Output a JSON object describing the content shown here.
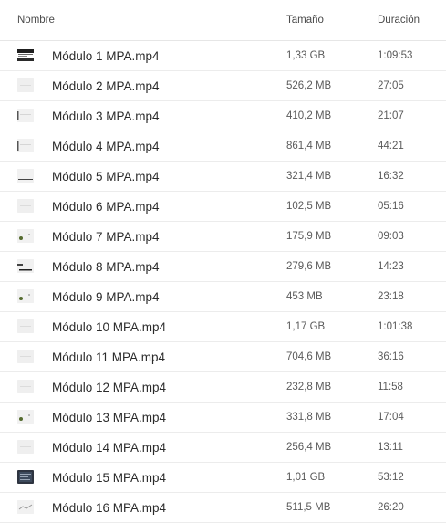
{
  "columns": {
    "name": "Nombre",
    "size": "Tamaño",
    "duration": "Duración"
  },
  "files": [
    {
      "name": "Módulo 1 MPA.mp4",
      "size": "1,33 GB",
      "duration": "1:09:53",
      "thumb": "dark-slide"
    },
    {
      "name": "Módulo 2 MPA.mp4",
      "size": "526,2 MB",
      "duration": "27:05",
      "thumb": "light"
    },
    {
      "name": "Módulo 3 MPA.mp4",
      "size": "410,2 MB",
      "duration": "21:07",
      "thumb": "light-left"
    },
    {
      "name": "Módulo 4 MPA.mp4",
      "size": "861,4 MB",
      "duration": "44:21",
      "thumb": "light-left"
    },
    {
      "name": "Módulo 5 MPA.mp4",
      "size": "321,4 MB",
      "duration": "16:32",
      "thumb": "light-line"
    },
    {
      "name": "Módulo 6 MPA.mp4",
      "size": "102,5 MB",
      "duration": "05:16",
      "thumb": "light"
    },
    {
      "name": "Módulo 7 MPA.mp4",
      "size": "175,9 MB",
      "duration": "09:03",
      "thumb": "light-dots"
    },
    {
      "name": "Módulo 8 MPA.mp4",
      "size": "279,6 MB",
      "duration": "14:23",
      "thumb": "light-bar"
    },
    {
      "name": "Módulo 9 MPA.mp4",
      "size": "453 MB",
      "duration": "23:18",
      "thumb": "light-dots"
    },
    {
      "name": "Módulo 10 MPA.mp4",
      "size": "1,17 GB",
      "duration": "1:01:38",
      "thumb": "light"
    },
    {
      "name": "Módulo 11 MPA.mp4",
      "size": "704,6 MB",
      "duration": "36:16",
      "thumb": "light"
    },
    {
      "name": "Módulo 12 MPA.mp4",
      "size": "232,8 MB",
      "duration": "11:58",
      "thumb": "light"
    },
    {
      "name": "Módulo 13 MPA.mp4",
      "size": "331,8 MB",
      "duration": "17:04",
      "thumb": "light-dots"
    },
    {
      "name": "Módulo 14 MPA.mp4",
      "size": "256,4 MB",
      "duration": "13:11",
      "thumb": "light"
    },
    {
      "name": "Módulo 15 MPA.mp4",
      "size": "1,01 GB",
      "duration": "53:12",
      "thumb": "dark-screen"
    },
    {
      "name": "Módulo 16 MPA.mp4",
      "size": "511,5 MB",
      "duration": "26:20",
      "thumb": "light-wave"
    }
  ]
}
